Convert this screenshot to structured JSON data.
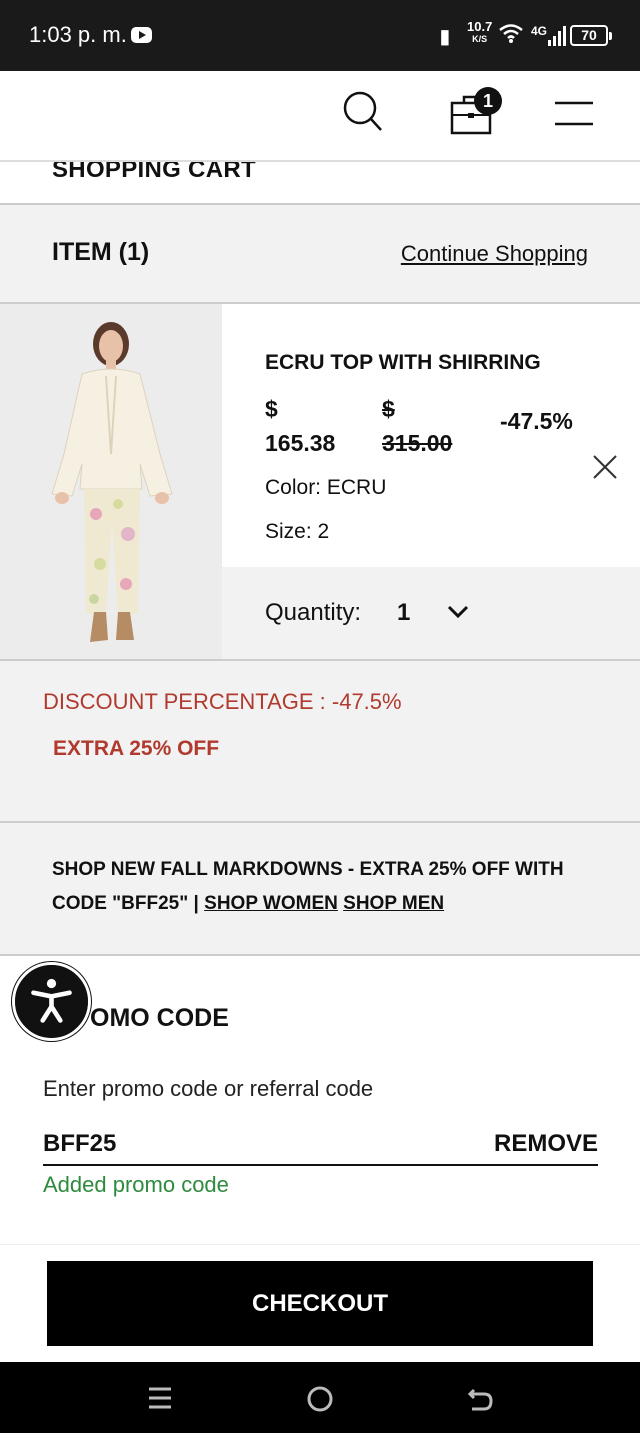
{
  "status_bar": {
    "time": "1:03 p. m.",
    "speed_value": "10.7",
    "speed_unit": "K/S",
    "network": "4G",
    "battery": "70"
  },
  "header": {
    "cart_badge": "1",
    "icons": [
      "search-icon",
      "shopping-bag-icon",
      "hamburger-menu-icon"
    ]
  },
  "cart": {
    "title": "SHOPPING CART",
    "item_count": "ITEM (1)",
    "continue_shopping": "Continue Shopping"
  },
  "item": {
    "name": "ECRU TOP WITH SHIRRING",
    "sale_currency": "$",
    "sale_price": "165.38",
    "orig_currency": "$",
    "orig_price": "315.00",
    "discount": "-47.5%",
    "color": "Color: ECRU",
    "size": "Size: 2",
    "quantity_label": "Quantity:",
    "quantity": "1"
  },
  "discount": {
    "percentage_line": "DISCOUNT PERCENTAGE :  -47.5%",
    "extra": "EXTRA 25% OFF"
  },
  "banner": {
    "text": "SHOP NEW FALL MARKDOWNS - EXTRA 25% OFF WITH CODE \"BFF25\" | ",
    "link_women": "SHOP WOMEN",
    "link_men": "SHOP MEN"
  },
  "promo": {
    "title": "PROMO CODE",
    "visible_title": "OMO CODE",
    "hint": "Enter promo code or referral code",
    "code": "BFF25",
    "remove": "REMOVE",
    "status": "Added promo code"
  },
  "checkout": {
    "label": "CHECKOUT"
  },
  "colors": {
    "accent_red": "#b03a2e",
    "success_green": "#2e8b3e",
    "button_black": "#000000"
  }
}
